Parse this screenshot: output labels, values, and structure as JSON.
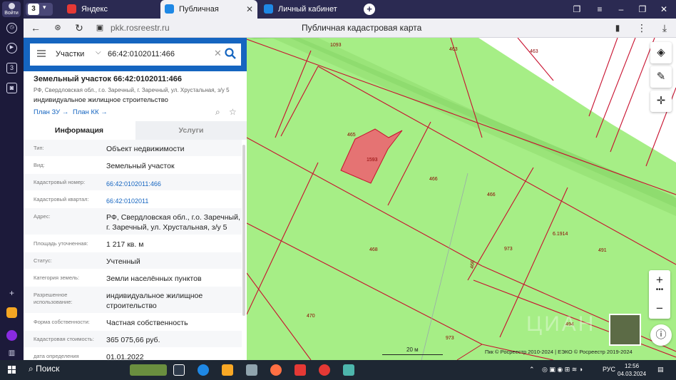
{
  "browser": {
    "login_label": "Войти",
    "tab_count": "3",
    "tabs": [
      {
        "label": "Яндекс"
      },
      {
        "label": "Публичная кадастрова"
      },
      {
        "label": "Личный кабинет"
      }
    ],
    "url": "pkk.rosreestr.ru",
    "page_title": "Публичная кадастровая карта"
  },
  "search": {
    "category": "Участки",
    "query": "66:42:0102011:466"
  },
  "parcel": {
    "title": "Земельный участок 66:42:0102011:466",
    "address_line": "РФ, Свердловская обл., г.о. Заречный, г. Заречный, ул. Хрустальная, з/у 5",
    "use": "индивидуальное жилищное строительство",
    "link_plan_zu": "План ЗУ →",
    "link_plan_kk": "План КК →"
  },
  "info_tabs": {
    "info": "Информация",
    "services": "Услуги"
  },
  "info_rows": [
    {
      "key": "Тип:",
      "value": "Объект недвижимости"
    },
    {
      "key": "Вид:",
      "value": "Земельный участок"
    },
    {
      "key": "Кадастровый номер:",
      "value": "66:42:0102011:466"
    },
    {
      "key": "Кадастровый квартал:",
      "value": "66:42:0102011"
    },
    {
      "key": "Адрес:",
      "value": "РФ, Свердловская обл., г.о. Заречный, г. Заречный, ул. Хрустальная, з/у 5"
    },
    {
      "key": "Площадь уточненная:",
      "value": "1 217 кв. м"
    },
    {
      "key": "Статус:",
      "value": "Учтенный"
    },
    {
      "key": "Категория земель:",
      "value": "Земли населённых пунктов"
    },
    {
      "key": "Разрешенное использование:",
      "value": "индивидуальное жилищное строительство"
    },
    {
      "key": "Форма собственности:",
      "value": "Частная собственность"
    },
    {
      "key": "Кадастровая стоимость:",
      "value": "365 075,66 руб."
    },
    {
      "key": "дата определения",
      "value": "01.01.2022"
    }
  ],
  "map": {
    "labels": [
      "1093",
      "463",
      "463",
      "465",
      "1593",
      "466",
      "466",
      "6.1914",
      "468",
      "973",
      "466",
      "491",
      "470",
      "973",
      "494"
    ],
    "scale": "20 м",
    "copyright": "Пкк © Росреестр 2010-2024 | ЕЭКО © Росреестр 2019-2024",
    "watermark": "ЦИАН",
    "colors": {
      "land": "#a6ee86",
      "road": "#8fdc6f",
      "parcel_line": "#c8102e",
      "selected": "#e57373"
    }
  },
  "taskbar": {
    "search": "Поиск",
    "lang": "РУС",
    "time": "12:56",
    "date": "04.03.2024"
  }
}
